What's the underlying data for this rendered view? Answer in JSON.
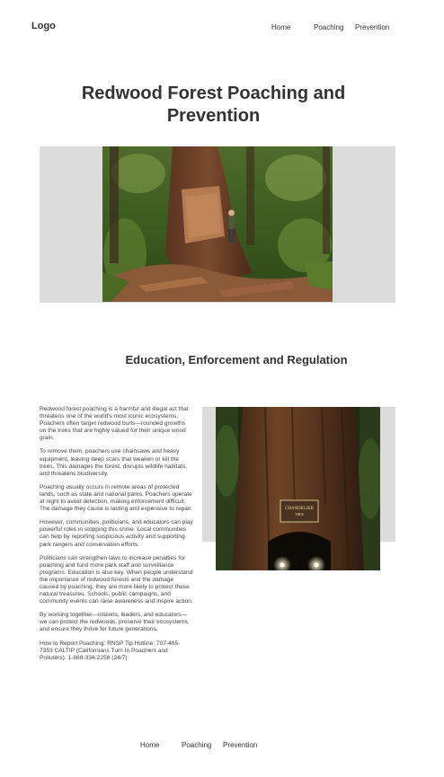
{
  "header": {
    "logo": "Logo",
    "nav": [
      {
        "label": "Home"
      },
      {
        "label": "Poaching"
      },
      {
        "label": "Prevention"
      }
    ]
  },
  "hero": {
    "title": "Redwood Forest Poaching and Prevention"
  },
  "section": {
    "heading": "Education, Enforcement and Regulation",
    "paragraphs": [
      "Redwood forest poaching is a harmful and illegal act that threatens one of the world's most iconic ecosystems. Poachers often target redwood burls—rounded growths on the trees that are highly valued for their unique wood grain.",
      "To remove them, poachers use chainsaws and heavy equipment, leaving deep scars that weaken or kill the trees. This damages the forest, disrupts wildlife habitats, and threatens biodiversity.",
      "Poaching usually occurs in remote areas of protected lands, such as state and national parks. Poachers operate at night to avoid detection, making enforcement difficult. The damage they cause is lasting and expensive to repair.",
      "However, communities, politicians, and educators can play powerful roles in stopping this crime. Local communities can help by reporting suspicious activity and supporting park rangers and conservation efforts.",
      "Politicians can strengthen laws to increase penalties for poaching and fund more park staff and surveillance programs. Education is also key. When people understand the importance of redwood forests and the damage caused by poaching, they are more likely to protect these natural treasures. Schools, public campaigns, and community events can raise awareness and inspire action.",
      "By working together—citizens, leaders, and educators—we can protect the redwoods, preserve their ecosystems, and ensure they thrive for future generations.",
      "How to Report Poaching: RNSP Tip Hotline: 707-465-7353 CALTIP (Californians Turn In Poachers and Polluters): 1-888-334-2258 (24/7)"
    ],
    "sign_text": "CHANDELIER TREE"
  },
  "footer": {
    "nav": [
      {
        "label": "Home"
      },
      {
        "label": "Poaching"
      },
      {
        "label": "Prevention"
      }
    ]
  }
}
